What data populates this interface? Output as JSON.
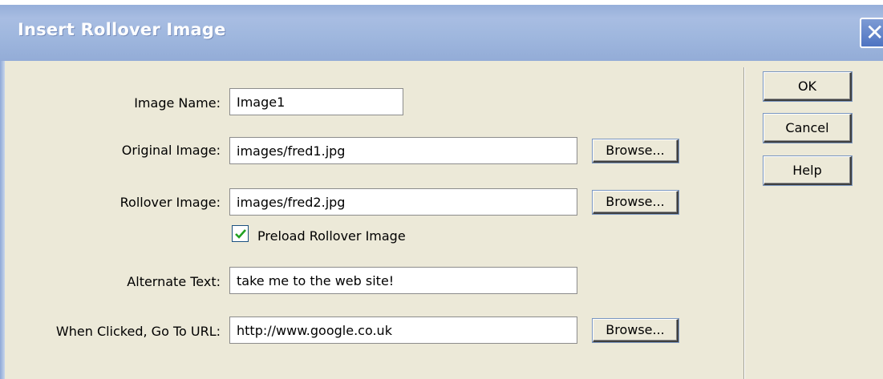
{
  "dialog": {
    "title": "Insert Rollover Image",
    "close_label": "✕"
  },
  "form": {
    "image_name": {
      "label": "Image Name:",
      "value": "Image1"
    },
    "original_image": {
      "label": "Original Image:",
      "value": "images/fred1.jpg",
      "browse_label": "Browse..."
    },
    "rollover_image": {
      "label": "Rollover Image:",
      "value": "images/fred2.jpg",
      "browse_label": "Browse..."
    },
    "preload": {
      "label": "Preload Rollover Image",
      "checked": true
    },
    "alternate_text": {
      "label": "Alternate Text:",
      "value": "take me to the web site!"
    },
    "url": {
      "label": "When Clicked, Go To URL:",
      "value": "http://www.google.co.uk",
      "browse_label": "Browse..."
    }
  },
  "buttons": {
    "ok": "OK",
    "cancel": "Cancel",
    "help": "Help"
  },
  "colors": {
    "titlebar": "#9fb7de",
    "dialog_bg": "#ece9d8",
    "checkmark": "#21a121"
  },
  "icons": {
    "close": "close-icon",
    "check": "checkmark-icon"
  }
}
